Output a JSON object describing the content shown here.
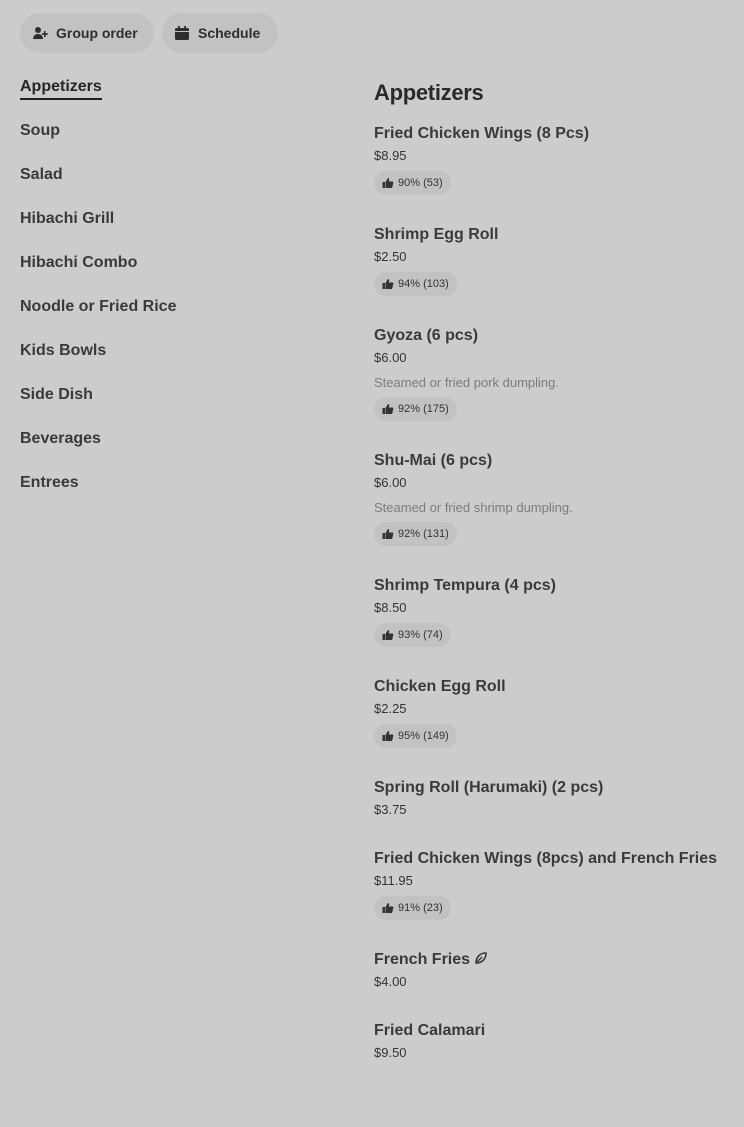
{
  "actions": {
    "group_order": "Group order",
    "schedule": "Schedule"
  },
  "nav": {
    "items": [
      {
        "label": "Appetizers",
        "active": true
      },
      {
        "label": "Soup"
      },
      {
        "label": "Salad"
      },
      {
        "label": "Hibachi Grill"
      },
      {
        "label": "Hibachi Combo"
      },
      {
        "label": "Noodle or Fried Rice"
      },
      {
        "label": "Kids Bowls"
      },
      {
        "label": "Side Dish"
      },
      {
        "label": "Beverages"
      },
      {
        "label": "Entrees"
      }
    ]
  },
  "menu": {
    "section_title": "Appetizers",
    "items": [
      {
        "name": "Fried Chicken Wings (8 Pcs)",
        "price": "$8.95",
        "rating": "90% (53)"
      },
      {
        "name": "Shrimp Egg Roll",
        "price": "$2.50",
        "rating": "94% (103)"
      },
      {
        "name": "Gyoza (6 pcs)",
        "price": "$6.00",
        "description": "Steamed or fried pork dumpling.",
        "rating": "92% (175)"
      },
      {
        "name": "Shu-Mai (6 pcs)",
        "price": "$6.00",
        "description": "Steamed or fried shrimp dumpling.",
        "rating": "92% (131)"
      },
      {
        "name": "Shrimp Tempura (4 pcs)",
        "price": "$8.50",
        "rating": "93% (74)"
      },
      {
        "name": "Chicken Egg Roll",
        "price": "$2.25",
        "rating": "95% (149)"
      },
      {
        "name": "Spring Roll (Harumaki) (2 pcs)",
        "price": "$3.75"
      },
      {
        "name": "Fried Chicken Wings (8pcs) and French Fries",
        "price": "$11.95",
        "rating": "91% (23)"
      },
      {
        "name": "French Fries",
        "price": "$4.00",
        "icon": "leaf-icon"
      },
      {
        "name": "Fried Calamari",
        "price": "$9.50"
      }
    ]
  },
  "colors": {
    "background": "#cccccc",
    "pill": "#c2c2c2",
    "text": "#1f1f1f",
    "muted": "#7c7c7c"
  }
}
